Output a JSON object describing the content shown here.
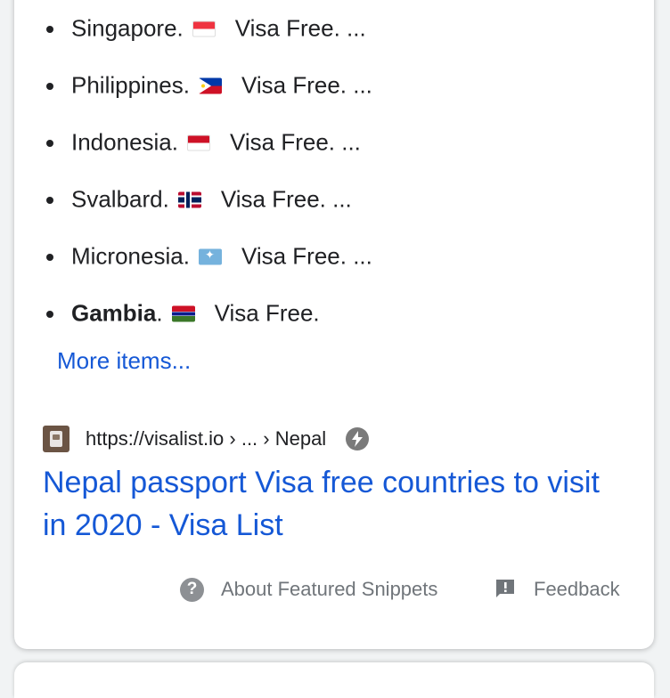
{
  "list": {
    "items": [
      {
        "country": "Singapore",
        "flag": "flag-sg",
        "suffix": "Visa Free. ...",
        "bold": false
      },
      {
        "country": "Philippines",
        "flag": "flag-ph",
        "suffix": "Visa Free. ...",
        "bold": false
      },
      {
        "country": "Indonesia",
        "flag": "flag-id",
        "suffix": "Visa Free. ...",
        "bold": false
      },
      {
        "country": "Svalbard",
        "flag": "flag-no",
        "suffix": "Visa Free. ...",
        "bold": false
      },
      {
        "country": "Micronesia",
        "flag": "flag-fm",
        "suffix": "Visa Free. ...",
        "bold": false
      },
      {
        "country": "Gambia",
        "flag": "flag-gm",
        "suffix": "Visa Free.",
        "bold": true
      }
    ]
  },
  "more_items_label": "More items...",
  "source": {
    "url": "https://visalist.io › ... › Nepal"
  },
  "result": {
    "title": "Nepal passport Visa free countries to visit in 2020 - Visa List"
  },
  "footer": {
    "about_label": "About Featured Snippets",
    "feedback_label": "Feedback"
  },
  "colors": {
    "link": "#1558d6",
    "text": "#202124",
    "muted": "#70757a"
  }
}
